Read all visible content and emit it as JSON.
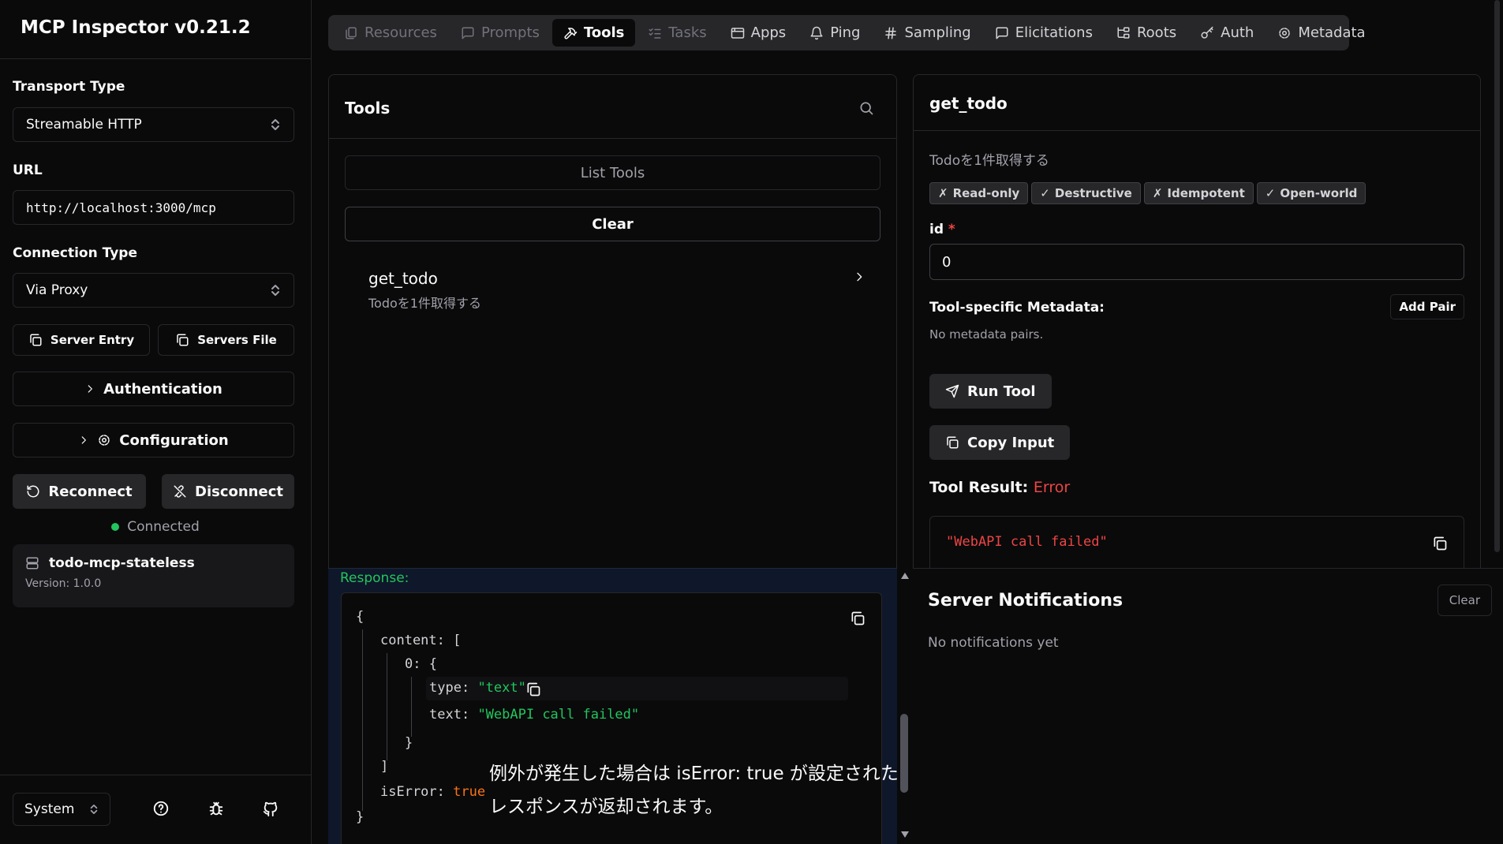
{
  "app": {
    "title": "MCP Inspector v0.21.2"
  },
  "sidebar": {
    "transport_label": "Transport Type",
    "transport_value": "Streamable HTTP",
    "url_label": "URL",
    "url_value": "http://localhost:3000/mcp",
    "connection_label": "Connection Type",
    "connection_value": "Via Proxy",
    "server_entry": "Server Entry",
    "servers_file": "Servers File",
    "authentication": "Authentication",
    "configuration": "Configuration",
    "reconnect": "Reconnect",
    "disconnect": "Disconnect",
    "status": "Connected",
    "server_name": "todo-mcp-stateless",
    "server_version": "Version: 1.0.0",
    "theme": "System"
  },
  "tabs": [
    {
      "label": "Resources",
      "icon": "files-icon",
      "state": "disabled"
    },
    {
      "label": "Prompts",
      "icon": "message-icon",
      "state": "disabled"
    },
    {
      "label": "Tools",
      "icon": "hammer-icon",
      "state": "active"
    },
    {
      "label": "Tasks",
      "icon": "list-checks-icon",
      "state": "disabled"
    },
    {
      "label": "Apps",
      "icon": "app-window-icon",
      "state": "normal"
    },
    {
      "label": "Ping",
      "icon": "bell-icon",
      "state": "normal"
    },
    {
      "label": "Sampling",
      "icon": "hash-icon",
      "state": "normal"
    },
    {
      "label": "Elicitations",
      "icon": "message-icon",
      "state": "normal"
    },
    {
      "label": "Roots",
      "icon": "folder-tree-icon",
      "state": "normal"
    },
    {
      "label": "Auth",
      "icon": "key-icon",
      "state": "normal"
    },
    {
      "label": "Metadata",
      "icon": "gear-icon",
      "state": "normal"
    }
  ],
  "tools_panel": {
    "title": "Tools",
    "list_button": "List Tools",
    "clear_button": "Clear",
    "items": [
      {
        "name": "get_todo",
        "description": "Todoを1件取得する"
      }
    ]
  },
  "detail": {
    "title": "get_todo",
    "description": "Todoを1件取得する",
    "badges": [
      {
        "mark": "✗",
        "label": "Read-only"
      },
      {
        "mark": "✓",
        "label": "Destructive"
      },
      {
        "mark": "✗",
        "label": "Idempotent"
      },
      {
        "mark": "✓",
        "label": "Open-world"
      }
    ],
    "param_label": "id",
    "param_required": "*",
    "param_value": "0",
    "metadata_label": "Tool-specific Metadata:",
    "add_pair": "Add Pair",
    "no_metadata": "No metadata pairs.",
    "run_tool": "Run Tool",
    "copy_input": "Copy Input",
    "result_label": "Tool Result:",
    "result_status": "Error",
    "result_text": "\"WebAPI call failed\""
  },
  "response": {
    "label": "Response:",
    "open_brace": "{",
    "content_key": "content:",
    "open_bracket": "[",
    "index_key": "0:",
    "inner_open": "{",
    "type_key": "type:",
    "type_value": "\"text\"",
    "text_key": "text:",
    "text_value": "\"WebAPI call failed\"",
    "inner_close": "}",
    "close_bracket": "]",
    "iserror_key": "isError:",
    "iserror_value": "true",
    "close_brace": "}"
  },
  "annotation": {
    "line1": "例外が発生した場合は isError: true が設定された",
    "line2": "レスポンスが返却されます。"
  },
  "notifications": {
    "title": "Server Notifications",
    "clear": "Clear",
    "empty": "No notifications yet"
  },
  "colors": {
    "accent_green": "#22c55e",
    "error_red": "#ef4444",
    "bool_orange": "#f97316"
  }
}
